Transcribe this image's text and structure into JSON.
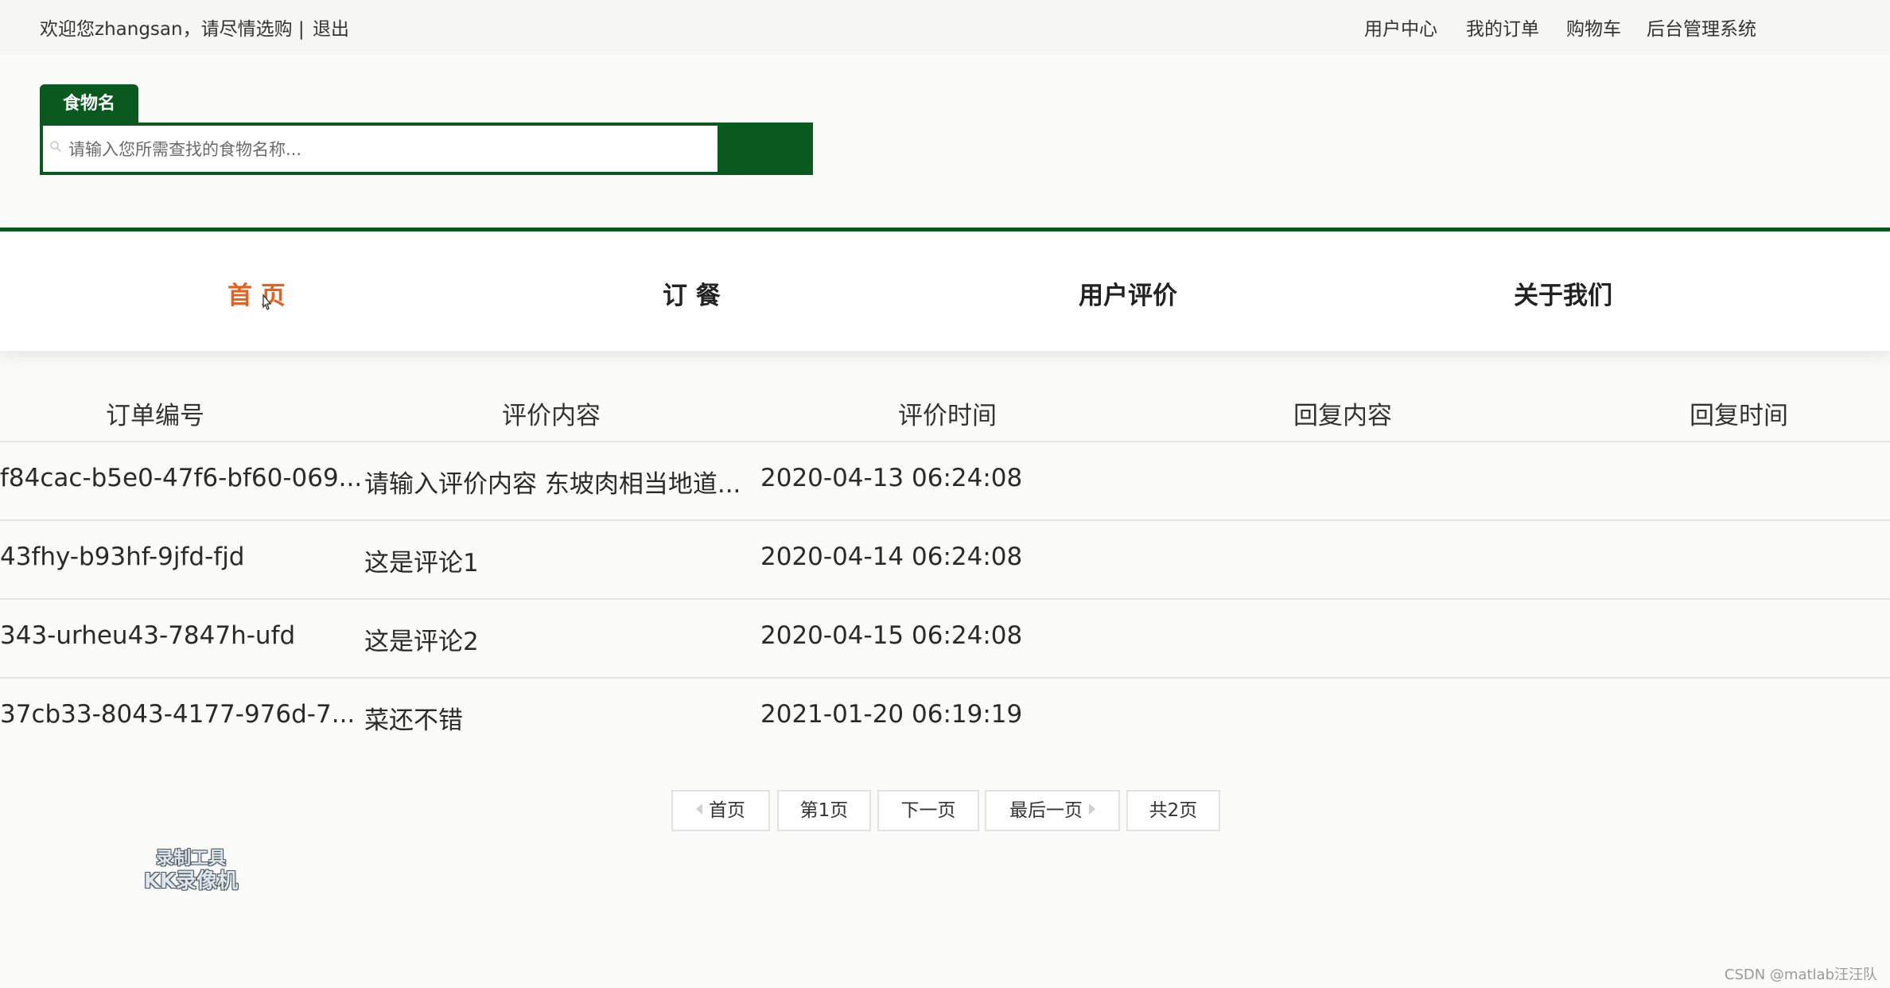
{
  "topbar": {
    "welcome": "欢迎您zhangsan，请尽情选购 |",
    "logout": "退出",
    "links": [
      "用户中心",
      "我的订单",
      "购物车",
      "后台管理系统"
    ]
  },
  "search": {
    "tab_label": "食物名",
    "placeholder": "请输入您所需查找的食物名称...",
    "value": ""
  },
  "nav": {
    "items": [
      "首 页",
      "订 餐",
      "用户评价",
      "关于我们"
    ],
    "active": "首 页"
  },
  "table": {
    "headers": [
      "订单编号",
      "评价内容",
      "评价时间",
      "回复内容",
      "回复时间"
    ],
    "rows": [
      {
        "order_id": "f84cac-b5e0-47f6-bf60-069...",
        "content": "请输入评价内容 东坡肉相当地道...",
        "time": "2020-04-13 06:24:08",
        "reply": "",
        "reply_time": ""
      },
      {
        "order_id": "43fhy-b93hf-9jfd-fjd",
        "content": "这是评论1",
        "time": "2020-04-14 06:24:08",
        "reply": "",
        "reply_time": ""
      },
      {
        "order_id": "343-urheu43-7847h-ufd",
        "content": "这是评论2",
        "time": "2020-04-15 06:24:08",
        "reply": "",
        "reply_time": ""
      },
      {
        "order_id": "37cb33-8043-4177-976d-7...",
        "content": "菜还不错",
        "time": "2021-01-20 06:19:19",
        "reply": "",
        "reply_time": ""
      }
    ]
  },
  "pagination": {
    "first": "首页",
    "current": "第1页",
    "next": "下一页",
    "last": "最后一页",
    "total": "共2页"
  },
  "watermark": {
    "line1": "录制工具",
    "line2": "KK录像机"
  },
  "footer_credit": "CSDN @matlab汪汪队",
  "colors": {
    "brand_green": "#0a5a1f",
    "active_orange": "#e8601c"
  }
}
